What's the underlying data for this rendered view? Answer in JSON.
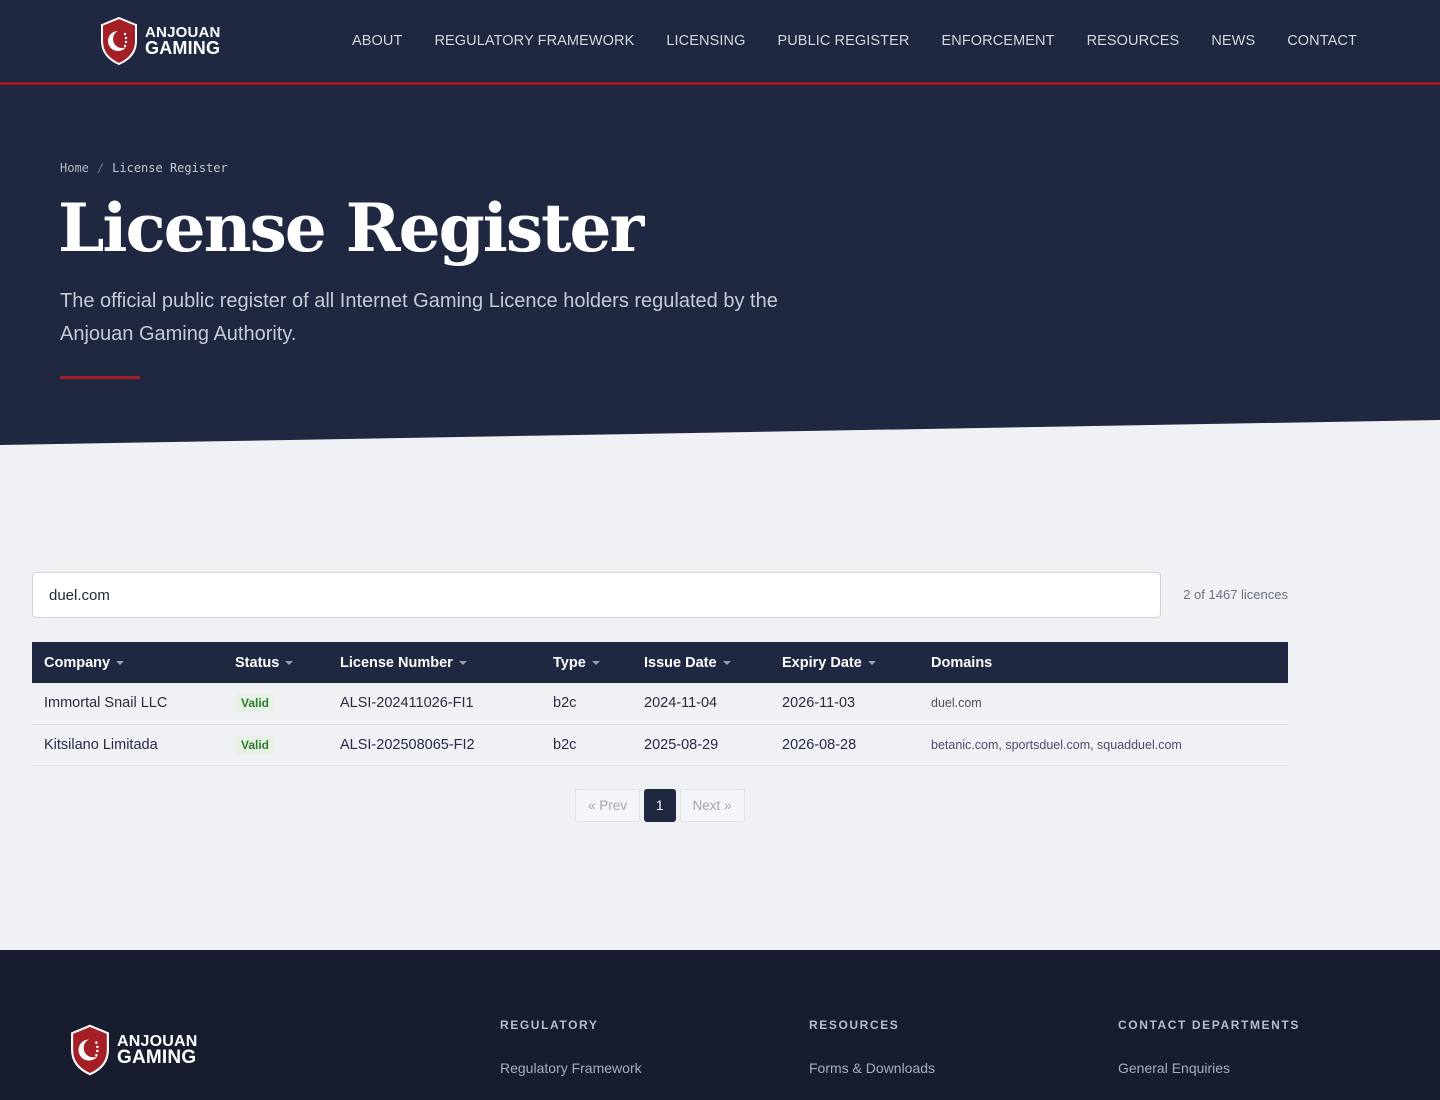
{
  "brand": {
    "line1": "ANJOUAN",
    "line2": "GAMING"
  },
  "nav": {
    "items": [
      "ABOUT",
      "REGULATORY FRAMEWORK",
      "LICENSING",
      "PUBLIC REGISTER",
      "ENFORCEMENT",
      "RESOURCES",
      "NEWS",
      "CONTACT"
    ]
  },
  "hero": {
    "breadcrumb_home": "Home",
    "breadcrumb_sep": "/",
    "breadcrumb_current": "License Register",
    "title": "License Register",
    "subtitle": "The official public register of all Internet Gaming Licence holders regulated by the Anjouan Gaming Authority."
  },
  "search": {
    "value": "duel.com"
  },
  "result_count": "2 of 1467 licences",
  "table": {
    "headers": [
      "Company",
      "Status",
      "License Number",
      "Type",
      "Issue Date",
      "Expiry Date",
      "Domains"
    ],
    "rows": [
      {
        "company": "Immortal Snail LLC",
        "status": "Valid",
        "license": "ALSI-202411026-FI1",
        "type": "b2c",
        "issue": "2024-11-04",
        "expiry": "2026-11-03",
        "domains": "duel.com"
      },
      {
        "company": "Kitsilano Limitada",
        "status": "Valid",
        "license": "ALSI-202508065-FI2",
        "type": "b2c",
        "issue": "2025-08-29",
        "expiry": "2026-08-28",
        "domains": "betanic.com, sportsduel.com, squadduel.com"
      }
    ]
  },
  "pagination": {
    "prev": "« Prev",
    "current": "1",
    "next": "Next »"
  },
  "footer": {
    "columns": [
      {
        "heading": "REGULATORY",
        "link": "Regulatory Framework"
      },
      {
        "heading": "RESOURCES",
        "link": "Forms & Downloads"
      },
      {
        "heading": "CONTACT DEPARTMENTS",
        "link": "General Enquiries"
      }
    ]
  },
  "colors": {
    "navy": "#1f2741",
    "accent_red": "#9b1b22",
    "valid_green": "#2d7a2d"
  }
}
